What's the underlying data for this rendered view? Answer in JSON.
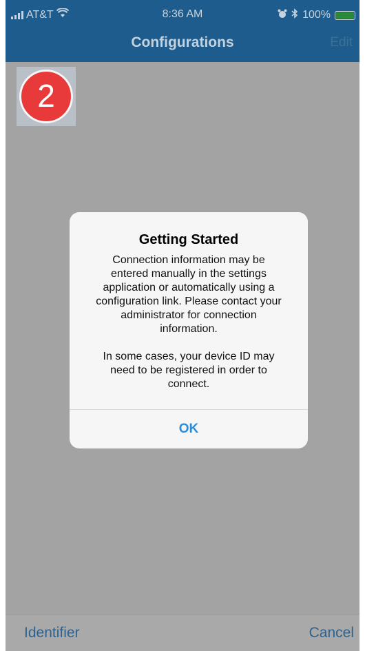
{
  "status_bar": {
    "carrier": "AT&T",
    "time": "8:36 AM",
    "battery": "100%"
  },
  "nav": {
    "title": "Configurations",
    "edit": "Edit"
  },
  "badge": {
    "number": "2"
  },
  "alert": {
    "title": "Getting Started",
    "message": "Connection information may be\nentered manually in the settings\napplication or automatically using a\nconfiguration link.  Please contact your\nadministrator for connection\ninformation.\n\nIn some cases, your device ID may\nneed to be registered in order to\nconnect.",
    "ok": "OK"
  },
  "toolbar": {
    "left": "Identifier",
    "right": "Cancel"
  }
}
